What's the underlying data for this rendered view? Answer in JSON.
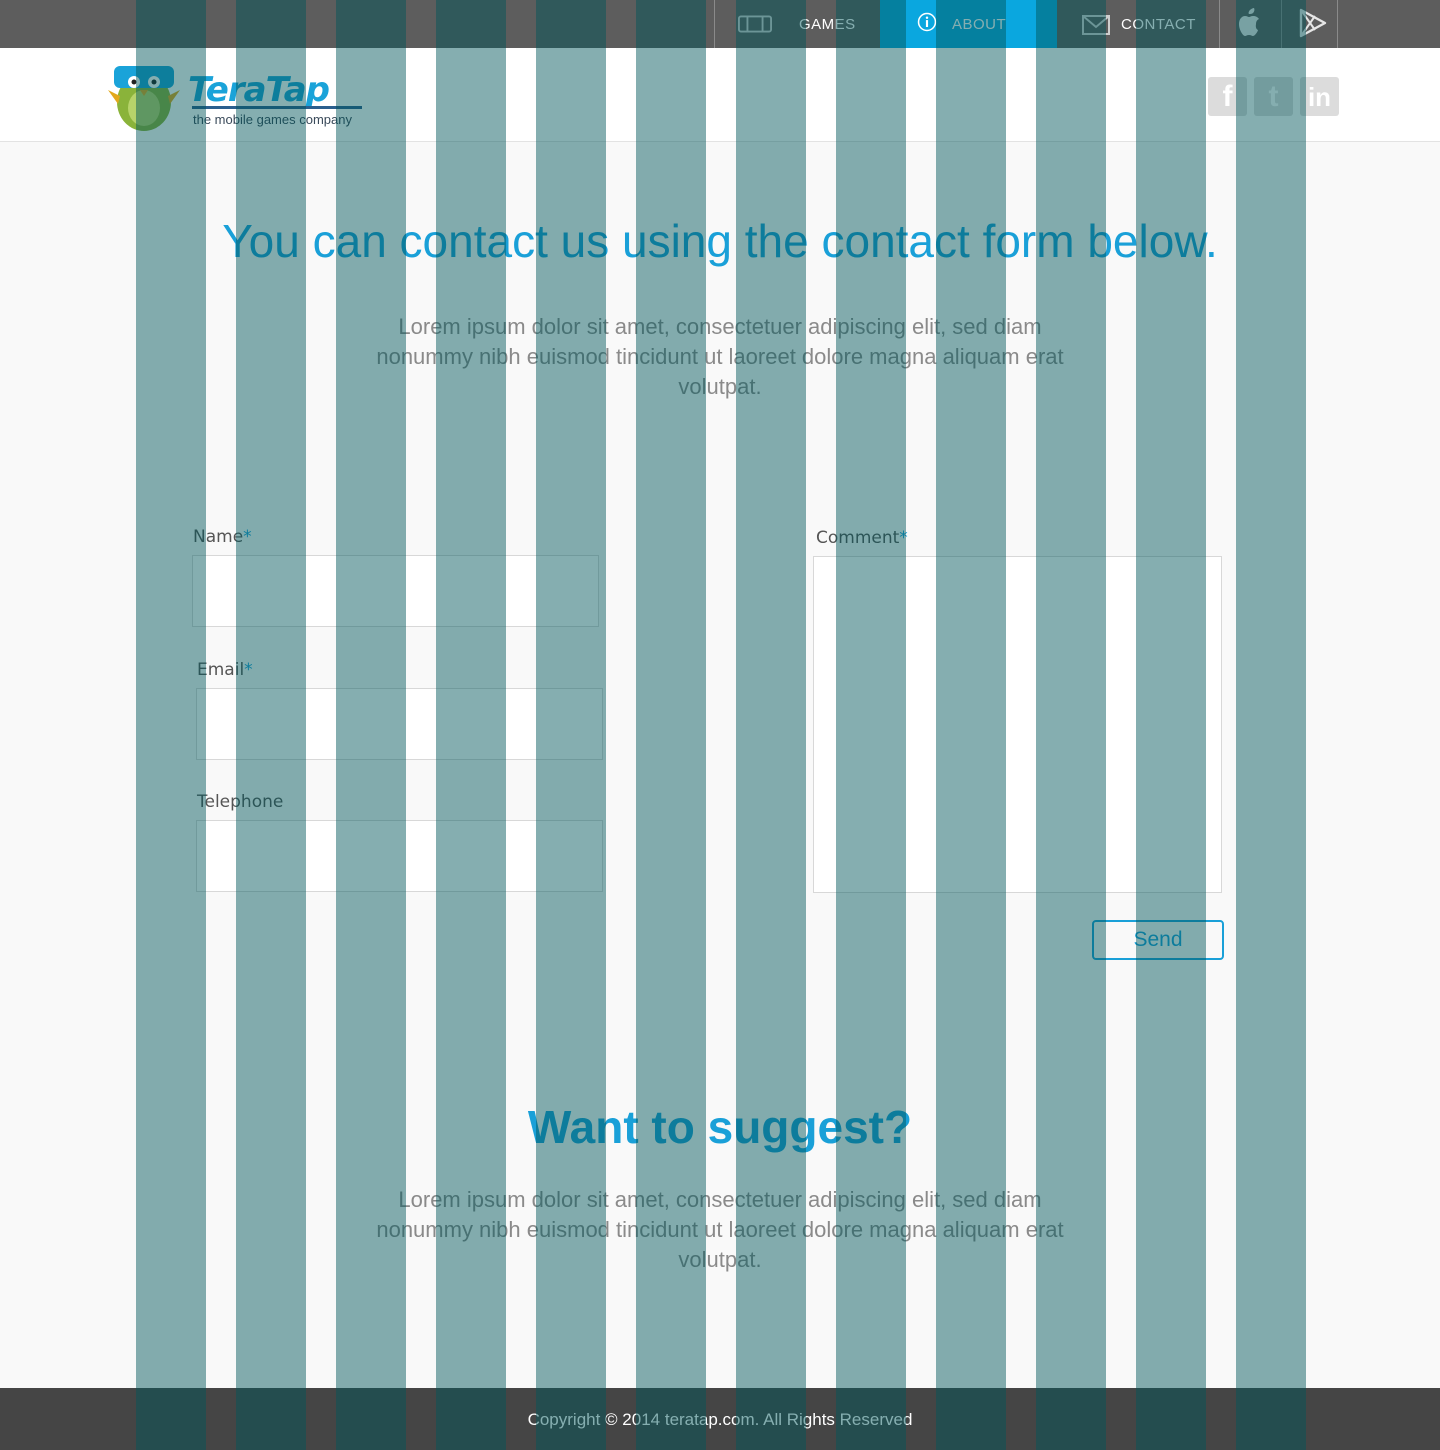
{
  "nav": {
    "items": [
      {
        "label": "GAMES",
        "icon": "gamepad-icon"
      },
      {
        "label": "ABOUT",
        "icon": "info-icon",
        "active": true
      },
      {
        "label": "CONTACT",
        "icon": "envelope-icon"
      }
    ],
    "stores": [
      "apple-icon",
      "google-play-icon"
    ],
    "active_color": "#0aa7df"
  },
  "header": {
    "brand": "TeraTap",
    "tagline": "the mobile games company",
    "social": [
      {
        "name": "facebook",
        "glyph": "f"
      },
      {
        "name": "twitter",
        "glyph": "t"
      },
      {
        "name": "linkedin",
        "glyph": "in"
      }
    ]
  },
  "hero": {
    "title": "You can contact us using the contact form below.",
    "text": "Lorem ipsum dolor sit amet, consectetuer adipiscing elit, sed diam nonummy nibh euismod tincidunt ut laoreet dolore magna aliquam erat volutpat."
  },
  "form": {
    "name_label": "Name",
    "email_label": "Email",
    "telephone_label": "Telephone",
    "comment_label": "Comment",
    "required_mark": "*",
    "name_value": "",
    "email_value": "",
    "telephone_value": "",
    "comment_value": "",
    "send_label": "Send"
  },
  "suggest": {
    "title": "Want to suggest?",
    "text": "Lorem ipsum dolor sit amet, consectetuer adipiscing elit, sed diam nonummy nibh euismod tincidunt ut laoreet dolore magna aliquam erat volutpat."
  },
  "footer": {
    "copyright": "Copyright © 2014 teratap.com. All Rights Reserved"
  },
  "colors": {
    "accent": "#1aa0d8",
    "topbar": "#5d5d5d",
    "footer": "#454545",
    "grid_overlay": "#00555a"
  }
}
